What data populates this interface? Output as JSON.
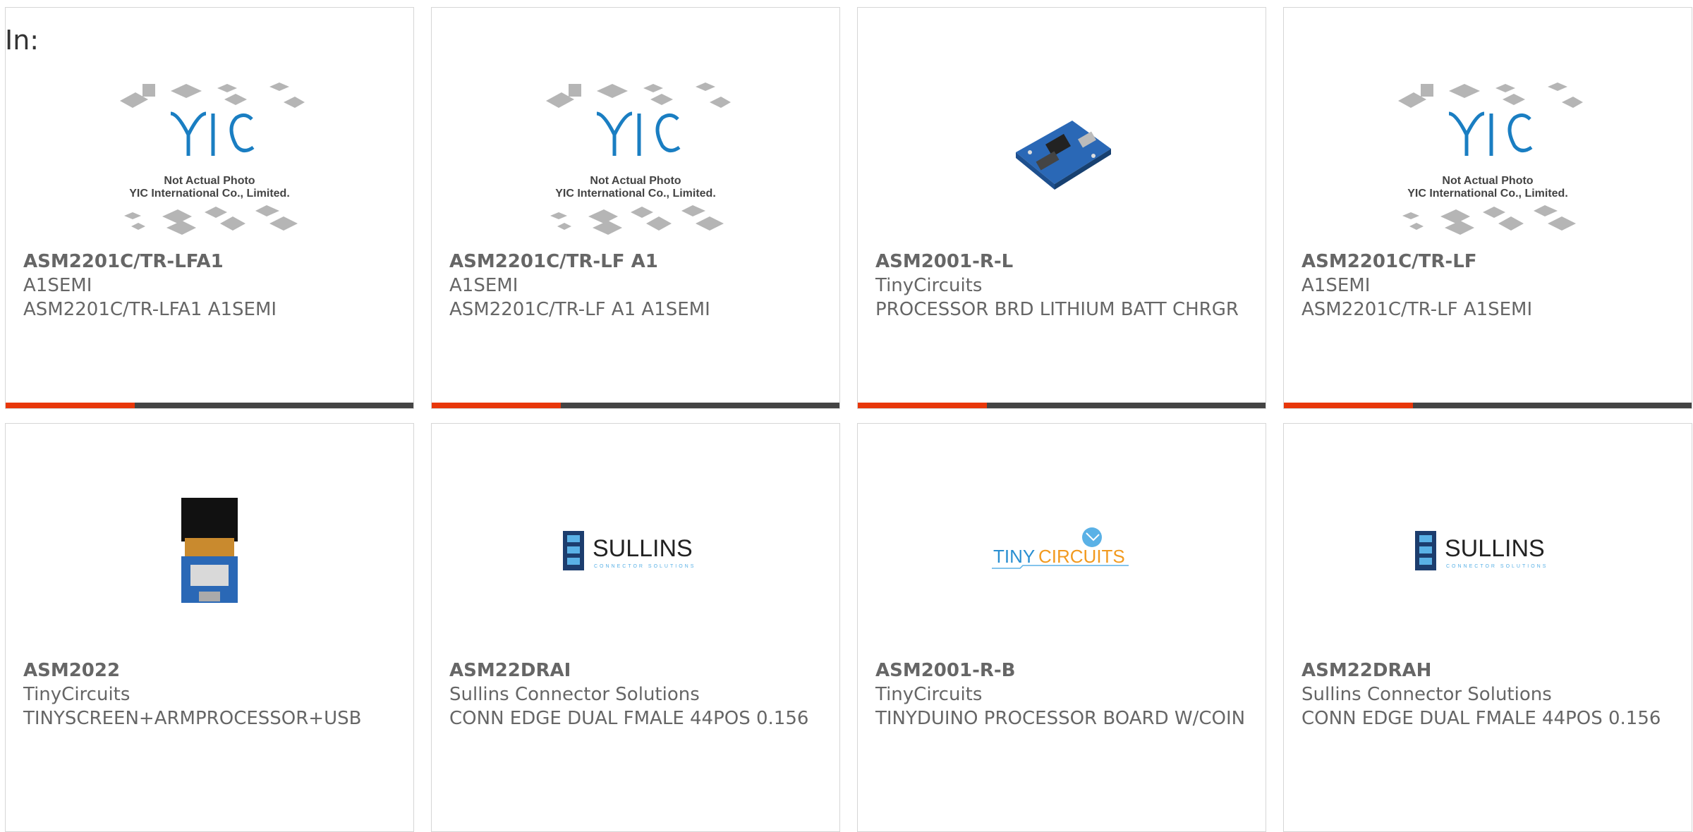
{
  "page": {
    "filter_label": "In:"
  },
  "accent_color": "#e8370a",
  "bar_color": "#444444",
  "products": [
    {
      "part_number": "ASM2201C/TR-LFA1",
      "manufacturer": "A1SEMI",
      "description": "ASM2201C/TR-LFA1 A1SEMI",
      "image": "yic-placeholder",
      "placeholder_line1": "Not Actual Photo",
      "placeholder_line2": "YIC International Co., Limited.",
      "placeholder_logo": "YIC"
    },
    {
      "part_number": "ASM2201C/TR-LF A1",
      "manufacturer": "A1SEMI",
      "description": "ASM2201C/TR-LF A1 A1SEMI",
      "image": "yic-placeholder",
      "placeholder_line1": "Not Actual Photo",
      "placeholder_line2": "YIC International Co., Limited.",
      "placeholder_logo": "YIC"
    },
    {
      "part_number": "ASM2001-R-L",
      "manufacturer": "TinyCircuits",
      "description": "PROCESSOR BRD LITHIUM BATT CHRGR",
      "image": "processor-board-photo"
    },
    {
      "part_number": "ASM2201C/TR-LF",
      "manufacturer": "A1SEMI",
      "description": "ASM2201C/TR-LF A1SEMI",
      "image": "yic-placeholder",
      "placeholder_line1": "Not Actual Photo",
      "placeholder_line2": "YIC International Co., Limited.",
      "placeholder_logo": "YIC"
    },
    {
      "part_number": "ASM2022",
      "manufacturer": "TinyCircuits",
      "description": "TINYSCREEN+ARMPROCESSOR+USB",
      "image": "tinyscreen-photo"
    },
    {
      "part_number": "ASM22DRAI",
      "manufacturer": "Sullins Connector Solutions",
      "description": "CONN EDGE DUAL FMALE 44POS 0.156",
      "image": "sullins-logo",
      "logo_text": "SULLINS",
      "logo_tagline": "CONNECTOR SOLUTIONS"
    },
    {
      "part_number": "ASM2001-R-B",
      "manufacturer": "TinyCircuits",
      "description": "TINYDUINO PROCESSOR BOARD W/COIN",
      "image": "tinycircuits-logo",
      "logo_text_a": "TINY",
      "logo_text_b": "CIRCUITS"
    },
    {
      "part_number": "ASM22DRAH",
      "manufacturer": "Sullins Connector Solutions",
      "description": "CONN EDGE DUAL FMALE 44POS 0.156",
      "image": "sullins-logo",
      "logo_text": "SULLINS",
      "logo_tagline": "CONNECTOR SOLUTIONS"
    }
  ]
}
